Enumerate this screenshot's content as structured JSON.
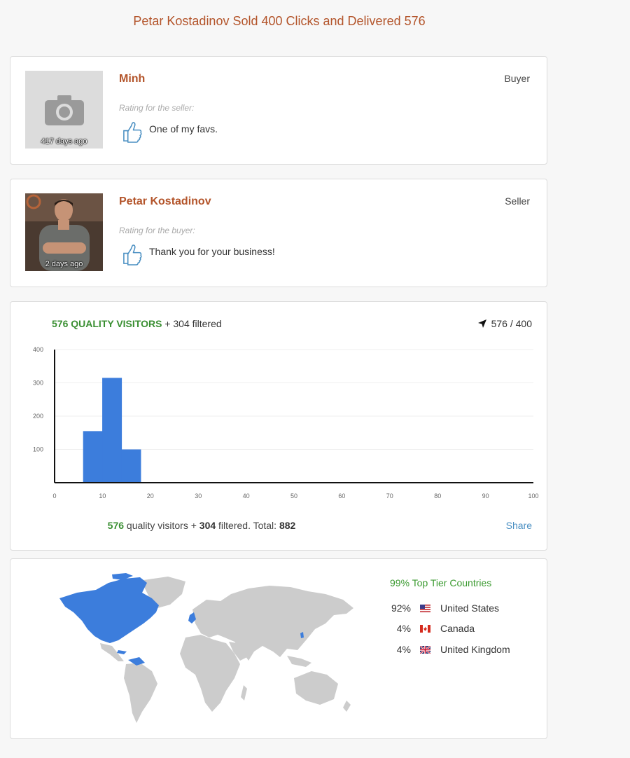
{
  "page": {
    "title": "Petar Kostadinov Sold 400 Clicks and Delivered 576"
  },
  "reviews": [
    {
      "name": "Minh",
      "role": "Buyer",
      "age": "417 days ago",
      "rating_label": "Rating for the seller:",
      "comment": "One of my favs.",
      "avatar_icon": "camera-icon"
    },
    {
      "name": "Petar Kostadinov",
      "role": "Seller",
      "age": "2 days ago",
      "rating_label": "Rating for the buyer:",
      "comment": "Thank you for your business!",
      "avatar_icon": "profile-photo"
    }
  ],
  "traffic": {
    "quality_count": "576",
    "quality_label": "QUALITY VISITORS",
    "filtered_text": "+ 304 filtered",
    "ratio": "576 / 400",
    "footer": {
      "quality": "576",
      "quality_text": "quality visitors +",
      "filtered": "304",
      "filtered_text": "filtered. Total:",
      "total": "882"
    },
    "share_label": "Share"
  },
  "chart_data": {
    "type": "bar",
    "x": [
      8,
      12,
      16
    ],
    "values": [
      155,
      315,
      100
    ],
    "bar_color": "#3c7ddc",
    "xlim": [
      0,
      100
    ],
    "ylim": [
      0,
      400
    ],
    "x_ticks": [
      0,
      10,
      20,
      30,
      40,
      50,
      60,
      70,
      80,
      90,
      100
    ],
    "y_ticks": [
      100,
      200,
      300,
      400
    ],
    "grid": true
  },
  "geo": {
    "tier_title": "99% Top Tier Countries",
    "countries": [
      {
        "pct": "92%",
        "name": "United States",
        "flag": "us-flag-icon"
      },
      {
        "pct": "4%",
        "name": "Canada",
        "flag": "ca-flag-icon"
      },
      {
        "pct": "4%",
        "name": "United Kingdom",
        "flag": "uk-flag-icon"
      }
    ],
    "highlight_color": "#3c7ddc",
    "land_color": "#cccccc"
  },
  "colors": {
    "accent": "#b3542a",
    "quality_green": "#3a8f32",
    "link_blue": "#4a8fc2"
  }
}
